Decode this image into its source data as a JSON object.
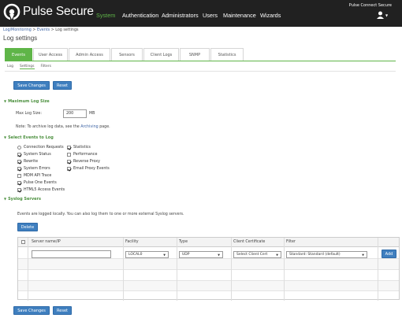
{
  "header": {
    "brand": "Pulse Secure",
    "product": "Pulse Connect Secure",
    "nav": [
      "System",
      "Authentication",
      "Administrators",
      "Users",
      "Maintenance",
      "Wizards"
    ],
    "active_nav": "System",
    "user_menu_caret": "▼"
  },
  "breadcrumb": {
    "items": [
      "Log/Monitoring",
      "Events",
      "Log settings"
    ],
    "sep": ">"
  },
  "page_title": "Log settings",
  "tabs": [
    "Events",
    "User Access",
    "Admin Access",
    "Sensors",
    "Client Logs",
    "SNMP",
    "Statistics"
  ],
  "subtabs": [
    "Log",
    "Settings",
    "Filters"
  ],
  "buttons": {
    "save": "Save Changes",
    "reset": "Reset",
    "delete": "Delete",
    "add": "Add"
  },
  "max_log": {
    "section": "Maximum Log Size",
    "label": "Max Log Size:",
    "value": "200",
    "unit": "MB",
    "note_pre": "Note: To archive log data, see the",
    "note_link": "Archiving",
    "note_post": "page."
  },
  "events": {
    "section": "Select Events to Log",
    "col1": [
      {
        "label": "Connection Requests",
        "checked": false
      },
      {
        "label": "System Status",
        "checked": true
      },
      {
        "label": "Rewrite",
        "checked": true
      },
      {
        "label": "System Errors",
        "checked": true
      },
      {
        "label": "MDM API Trace",
        "checked": false
      },
      {
        "label": "Pulse One Events",
        "checked": true
      },
      {
        "label": "HTML5 Access Events",
        "checked": true
      }
    ],
    "col2": [
      {
        "label": "Statistics",
        "checked": true
      },
      {
        "label": "Performance",
        "checked": false
      },
      {
        "label": "Reverse Proxy",
        "checked": true
      },
      {
        "label": "Email Proxy Events",
        "checked": true
      }
    ]
  },
  "syslog": {
    "section": "Syslog Servers",
    "desc": "Events are logged locally. You can also log them to one or more external Syslog servers.",
    "columns": [
      "Server name/IP",
      "Facility",
      "Type",
      "Client Certificate",
      "Filter"
    ],
    "new_row": {
      "server": "",
      "facility": "LOCAL0",
      "type": "UDP",
      "cert": "Select Client Cert",
      "filter": "Standard: Standard (default)"
    }
  }
}
